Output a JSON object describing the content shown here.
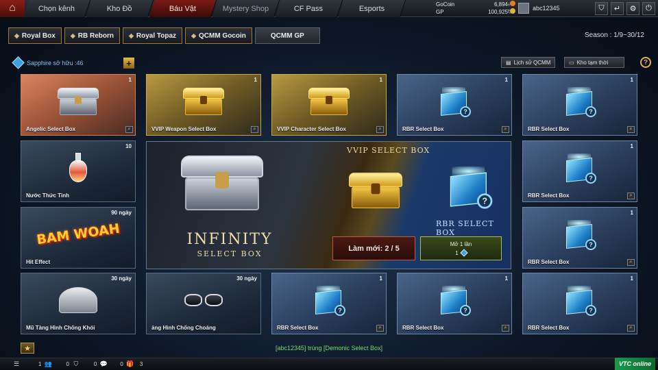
{
  "nav": {
    "tabs": [
      "Chọn kênh",
      "Kho Đồ",
      "Báu Vật",
      "Mystery Shop",
      "CF Pass",
      "Esports"
    ]
  },
  "currency": {
    "gocoin_label": "GoCoin",
    "gocoin_value": "6,894",
    "gp_label": "GP",
    "gp_value": "100,925"
  },
  "user": {
    "name": "abc12345"
  },
  "subtabs": [
    "Royal Box",
    "RB Reborn",
    "Royal Topaz",
    "QCMM Gocoin",
    "QCMM GP"
  ],
  "season": "Season : 1/9~30/12",
  "sapphire_label": "Sapphire sở hữu :46",
  "buttons": {
    "history": "Lịch sử QCMM",
    "storage": "Kho tạm thời"
  },
  "cards": [
    {
      "name": "Angelic Select Box",
      "count": "1"
    },
    {
      "name": "VVIP Weapon Select Box",
      "count": "1"
    },
    {
      "name": "VVIP Character Select Box",
      "count": "1"
    },
    {
      "name": "RBR Select Box",
      "count": "1"
    },
    {
      "name": "RBR Select Box",
      "count": "1"
    },
    {
      "name": "Nước Thức Tỉnh",
      "count": "10"
    },
    {
      "name": "RBR Select Box",
      "count": "1"
    },
    {
      "name": "Hit Effect",
      "count": "90 ngày"
    },
    {
      "name": "RBR Select Box",
      "count": "1"
    },
    {
      "name": "Mũ Tàng Hình Chống Khói",
      "count": "30 ngày"
    },
    {
      "name": "ảng Hình Chống Choáng",
      "count": "30 ngày"
    },
    {
      "name": "RBR Select Box",
      "count": "1"
    },
    {
      "name": "RBR Select Box",
      "count": "1"
    },
    {
      "name": "RBR Select Box",
      "count": "1"
    }
  ],
  "banner": {
    "infinity": "INFINITY",
    "select_box": "SELECT BOX",
    "vvip_label": "VVIP SELECT BOX",
    "rbr_label": "RBR SELECT BOX",
    "refresh_label": "Làm mới: 2 / 5",
    "open_label": "Mở 1 lần",
    "open_cost": "1"
  },
  "hit_effect_art": "BAM WOAH",
  "notice": "[abc12345] trúng [Demonic Select Box]",
  "bottombar": {
    "a": "1",
    "b": "0",
    "c": "0",
    "d": "0",
    "e": "3"
  },
  "logo": "VTC online"
}
